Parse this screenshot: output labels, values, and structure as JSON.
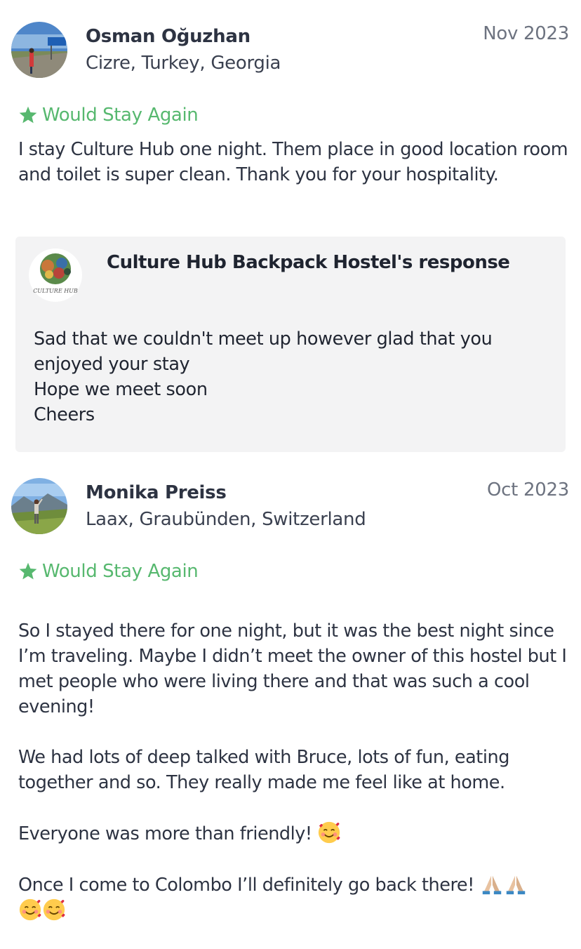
{
  "reviews": [
    {
      "reviewer_name": "Osman Oğuzhan",
      "location": "Cizre, Turkey, Georgia",
      "date": "Nov 2023",
      "badge": "Would Stay Again",
      "text": "I stay Culture Hub one night. Them place in good location room and toilet is super clean. Thank you for your hospitality.",
      "response": {
        "title": "Culture Hub Backpack Hostel's response",
        "logo_text": "CULTURE HUB",
        "text": "Sad that we couldn't meet up however glad that you enjoyed your stay\nHope we meet soon\nCheers"
      }
    },
    {
      "reviewer_name": "Monika Preiss",
      "location": "Laax, Graubünden, Switzerland",
      "date": "Oct 2023",
      "badge": "Would Stay Again",
      "text_lines": [
        "So I stayed there for one night, but it was the best night since I’m traveling. Maybe I didn’t meet the owner of this hostel but I met people who were living there and that was such a cool evening!",
        "We had lots of deep talked with Bruce, lots of fun, eating together and so. They really made me feel like at home.",
        "Everyone was more than friendly!",
        "Once I come to Colombo I’ll definitely go back there!"
      ]
    }
  ],
  "icons": {
    "badge_star": "star-icon",
    "smiling_face_with_hearts": "smiling-face-with-hearts-emoji",
    "folded_hands": "folded-hands-emoji"
  },
  "colors": {
    "accent_green": "#57b86f",
    "response_background": "#f3f3f4",
    "text_dark": "#2d3342",
    "date_gray": "#6d7380"
  }
}
